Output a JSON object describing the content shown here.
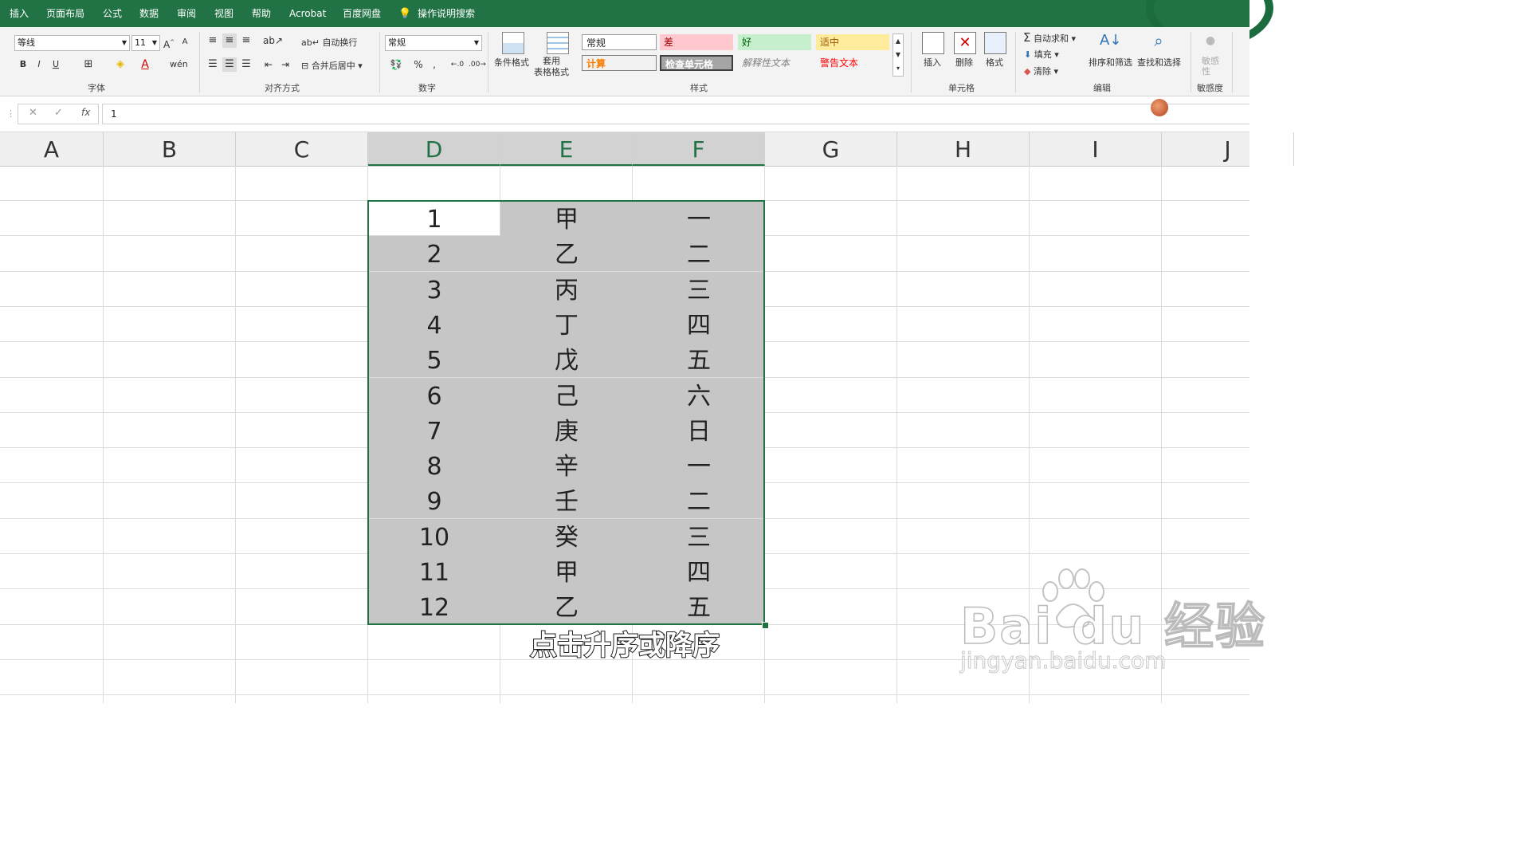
{
  "ribbon_tabs": [
    "插入",
    "页面布局",
    "公式",
    "数据",
    "审阅",
    "视图",
    "帮助",
    "Acrobat",
    "百度网盘"
  ],
  "tell_me": "操作说明搜索",
  "font": {
    "name": "等线",
    "size": "11",
    "group_label": "字体",
    "bold": "B",
    "italic": "I",
    "underline": "U"
  },
  "alignment": {
    "wrap_label": "自动换行",
    "merge_label": "合并后居中",
    "group_label": "对齐方式"
  },
  "number": {
    "format": "常规",
    "percent": "%",
    "comma": ",",
    "group_label": "数字"
  },
  "styles": {
    "cond_format_label": "条件格式",
    "table_format_label": "套用\n表格格式",
    "cell_styles": [
      "常规",
      "差",
      "好",
      "适中",
      "计算",
      "检查单元格",
      "解释性文本",
      "警告文本"
    ],
    "group_label": "样式"
  },
  "cells_group": {
    "insert": "插入",
    "delete": "删除",
    "format": "格式",
    "group_label": "单元格"
  },
  "editing": {
    "autosum": "自动求和",
    "fill": "填充",
    "clear": "清除",
    "sort_filter": "排序和筛选",
    "find_select": "查找和选择",
    "group_label": "编辑"
  },
  "sensitivity": {
    "label": "敏感\n性",
    "group_label": "敏感度"
  },
  "formula_bar": {
    "cancel": "✕",
    "enter": "✓",
    "fx": "fx",
    "value": "1"
  },
  "columns": [
    "A",
    "B",
    "C",
    "D",
    "E",
    "F",
    "G",
    "H",
    "I",
    "J"
  ],
  "selected_columns": [
    "D",
    "E",
    "F"
  ],
  "table": {
    "col_d": [
      "1",
      "2",
      "3",
      "4",
      "5",
      "6",
      "7",
      "8",
      "9",
      "10",
      "11",
      "12"
    ],
    "col_e": [
      "甲",
      "乙",
      "丙",
      "丁",
      "戊",
      "己",
      "庚",
      "辛",
      "壬",
      "癸",
      "甲",
      "乙"
    ],
    "col_f": [
      "一",
      "二",
      "三",
      "四",
      "五",
      "六",
      "日",
      "一",
      "二",
      "三",
      "四",
      "五"
    ]
  },
  "subtitle": "点击升序或降序",
  "watermark": {
    "brand": "Bai du 经验",
    "url": "jingyan.baidu.com"
  },
  "colors": {
    "excel_green": "#217346",
    "selection_fill": "#c6c6c6",
    "bad_fill": "#ffc7ce",
    "good_fill": "#c6efce",
    "neutral_fill": "#ffeb9c"
  }
}
